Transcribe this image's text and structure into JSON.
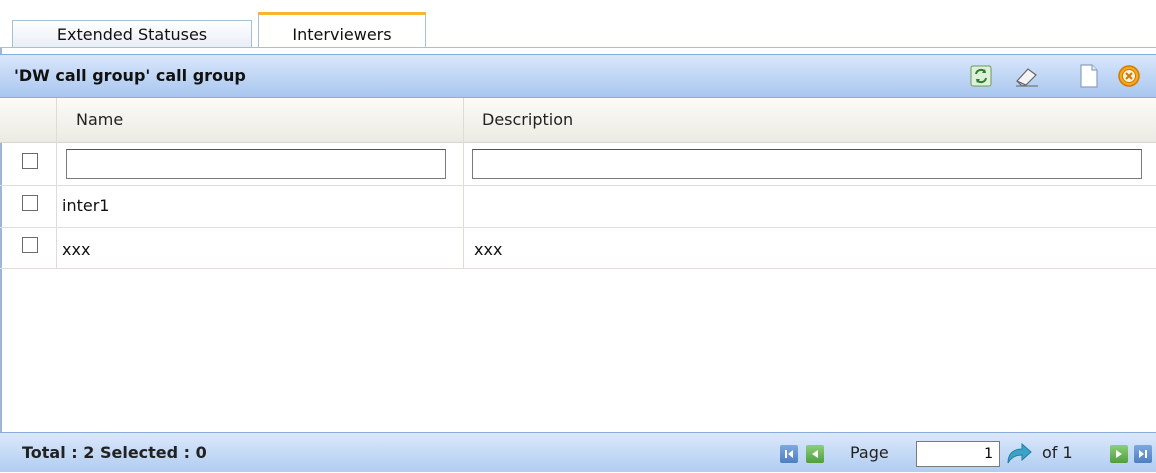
{
  "tabs": [
    {
      "label": "Extended Statuses"
    },
    {
      "label": "Interviewers"
    }
  ],
  "panel": {
    "title": "'DW call group' call group"
  },
  "toolbar": {
    "icons": [
      "refresh-icon",
      "eraser-icon",
      "new-document-icon",
      "delete-icon"
    ]
  },
  "grid": {
    "columns": [
      "Name",
      "Description"
    ],
    "filters": {
      "name": "",
      "description": ""
    },
    "rows": [
      {
        "name": "inter1",
        "description": ""
      },
      {
        "name": "xxx",
        "description": "xxx"
      }
    ]
  },
  "footer": {
    "summary": "Total : 2 Selected : 0",
    "page_label": "Page",
    "page_value": "1",
    "of_label": "of 1"
  },
  "colors": {
    "header_blue": "#a9c6ef",
    "active_tab_accent": "#f7b733"
  }
}
